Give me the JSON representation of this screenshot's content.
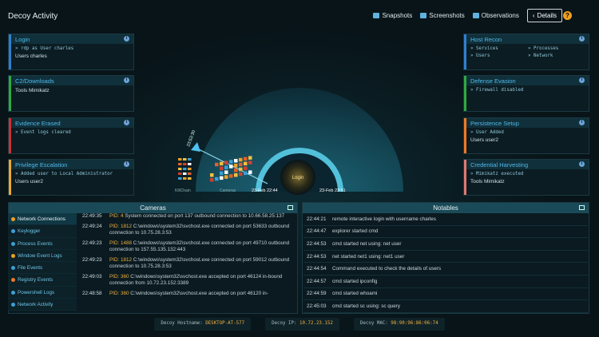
{
  "title": "Decoy Activity",
  "toolbar": {
    "snapshots": "Snapshots",
    "screenshots": "Screenshots",
    "observations": "Observations",
    "details": "Details",
    "help": "?"
  },
  "left_cards": [
    {
      "title": "Login",
      "color": "#2f7fd0",
      "lines": [
        "» rdp as User charles"
      ],
      "strong": "Users charles",
      "strong_icon": "users-icon"
    },
    {
      "title": "C2/Downloads",
      "color": "#2faa40",
      "lines": [],
      "strong": "Tools  Mimikatz",
      "strong_icon": "wrench-icon"
    },
    {
      "title": "Evidence Erased",
      "color": "#d03030",
      "lines": [
        "» Event logs cleared"
      ],
      "strong": "",
      "strong_icon": ""
    },
    {
      "title": "Privilege Escalation",
      "color": "#f0a830",
      "lines": [
        "» Added user to Local Administrator"
      ],
      "strong": "Users  user2",
      "strong_icon": "users-icon"
    }
  ],
  "right_cards": [
    {
      "title": "Host Recon",
      "color": "#2f7fd0",
      "grid": [
        "» Services",
        "» Processes",
        "» Users",
        "» Network"
      ]
    },
    {
      "title": "Defense Evasion",
      "color": "#2faa40",
      "lines": [
        "» Firewall disabled"
      ],
      "strong": ""
    },
    {
      "title": "Persistence Setup",
      "color": "#f07a20",
      "lines": [
        "» User Added"
      ],
      "strong": "Users  user2"
    },
    {
      "title": "Credential Harvesting",
      "color": "#e07870",
      "lines": [
        "» Mimikatz executed"
      ],
      "strong": "Tools  Mimikatz"
    }
  ],
  "viz": {
    "center": "Login",
    "time_label": "23:53:30",
    "kill_label": "KillChain",
    "cameras_label": "Cameras",
    "date_left": "23-Feb 22:44",
    "date_right": "23-Feb 23:51"
  },
  "cameras": {
    "title": "Cameras",
    "tabs": [
      {
        "label": "Network Connections",
        "color": "#f0a020",
        "active": true
      },
      {
        "label": "Keylogger",
        "color": "#3aa0d8",
        "active": false
      },
      {
        "label": "Process Events",
        "color": "#3aa0d8",
        "active": false
      },
      {
        "label": "Window Event Logs",
        "color": "#f0a020",
        "active": false
      },
      {
        "label": "File Events",
        "color": "#3aa0d8",
        "active": false
      },
      {
        "label": "Registry Events",
        "color": "#f07a20",
        "active": false
      },
      {
        "label": "Powershell Logs",
        "color": "#3aa0d8",
        "active": false
      },
      {
        "label": "Network Activity",
        "color": "#3aa0d8",
        "active": false
      }
    ],
    "logs": [
      {
        "time": "22:49:35",
        "pid": "PID: 4",
        "msg": " System connected on port 137 outbound connection to 10.66.58.25:137"
      },
      {
        "time": "22:49:24",
        "pid": "PID: 1812",
        "msg": " C:\\windows\\system32\\svchost.exe connected on port 53633 outbound connection to 10.75.28.3:53"
      },
      {
        "time": "22:49:23",
        "pid": "PID: 1488",
        "msg": " C:\\windows\\system32\\svchost.exe connected on port 49710 outbound connection to 157.55.135.132:443"
      },
      {
        "time": "22:49:23",
        "pid": "PID: 1812",
        "msg": " C:\\windows\\system32\\svchost.exe connected on port 59012 outbound connection to 10.75.28.3:53"
      },
      {
        "time": "22:49:03",
        "pid": "PID: 360",
        "msg": " C:\\windows\\system32\\svchost.exe accepted on port 46124 in-bound connection from 10.72.23.152:3389"
      },
      {
        "time": "22:48:58",
        "pid": "PID: 360",
        "msg": " C:\\windows\\system32\\svchost.exe accepted on port 46120 in-"
      }
    ]
  },
  "notables": {
    "title": "Notables",
    "rows": [
      {
        "time": "22:44:21",
        "msg": "remote interactive login with username charles"
      },
      {
        "time": "22:44:47",
        "msg": "explorer started cmd"
      },
      {
        "time": "22:44:53",
        "msg": "cmd started net using: net user"
      },
      {
        "time": "22:44:53",
        "msg": "net started net1 using: net1 user"
      },
      {
        "time": "22:44:54",
        "msg": "Command executed to check the details of users"
      },
      {
        "time": "22:44:57",
        "msg": "cmd started ipconfig"
      },
      {
        "time": "22:44:59",
        "msg": "cmd started whoami"
      },
      {
        "time": "22:45:03",
        "msg": "cmd started sc using: sc query"
      }
    ]
  },
  "footer": {
    "hostname_label": "Decoy Hostname:",
    "hostname": "DESKTOP-AT-577",
    "ip_label": "Decoy IP:",
    "ip": "10.72.23.152",
    "mac_label": "Decoy MAC:",
    "mac": "98:90:96:86:06:74"
  }
}
